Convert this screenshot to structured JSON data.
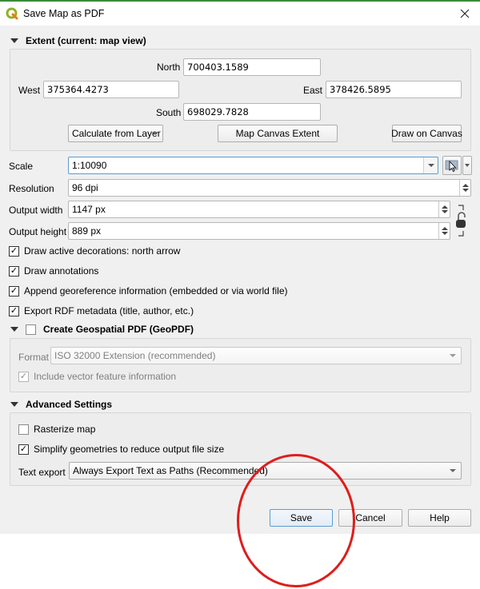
{
  "window": {
    "title": "Save Map as PDF",
    "app_icon": "qgis-logo-icon",
    "close_icon": "close-icon",
    "accent_color": "#589632"
  },
  "extent": {
    "header": "Extent (current: map view)",
    "north_label": "North",
    "north_value": "700403.1589",
    "west_label": "West",
    "west_value": "375364.4273",
    "east_label": "East",
    "east_value": "378426.5895",
    "south_label": "South",
    "south_value": "698029.7828",
    "calc_from_layer": "Calculate from Layer",
    "map_canvas_extent": "Map Canvas Extent",
    "draw_on_canvas": "Draw on Canvas"
  },
  "settings": {
    "scale_label": "Scale",
    "scale_value": "1:10090",
    "resolution_label": "Resolution",
    "resolution_value": "96 dpi",
    "output_width_label": "Output width",
    "output_width_value": "1147 px",
    "output_height_label": "Output height",
    "output_height_value": "889 px"
  },
  "options": [
    {
      "label": "Draw active decorations: north arrow",
      "checked": true
    },
    {
      "label": "Draw annotations",
      "checked": true
    },
    {
      "label": "Append georeference information (embedded or via world file)",
      "checked": true
    },
    {
      "label": "Export RDF metadata (title, author, etc.)",
      "checked": true
    }
  ],
  "geopdf": {
    "header": "Create Geospatial PDF (GeoPDF)",
    "checked": false,
    "format_label": "Format",
    "format_value": "ISO 32000 Extension (recommended)",
    "include_vector_label": "Include vector feature information",
    "include_vector_checked": true
  },
  "advanced": {
    "header": "Advanced Settings",
    "rasterize_label": "Rasterize map",
    "rasterize_checked": false,
    "simplify_label": "Simplify geometries to reduce output file size",
    "simplify_checked": true,
    "text_export_label": "Text export",
    "text_export_value": "Always Export Text as Paths (Recommended)"
  },
  "buttons": {
    "save": "Save",
    "cancel": "Cancel",
    "help": "Help"
  },
  "annotation": {
    "color": "#e01c1c",
    "target": "save-button"
  }
}
